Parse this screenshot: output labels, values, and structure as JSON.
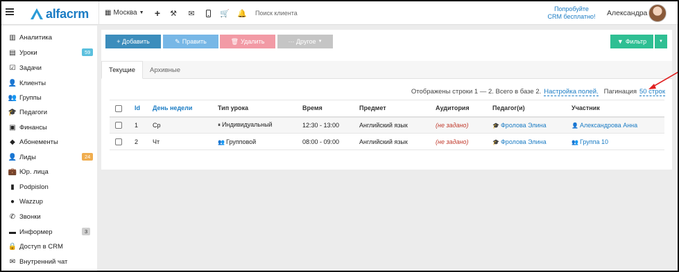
{
  "header": {
    "logo_text": "alfacrm",
    "city": "Москва",
    "search_placeholder": "Поиск клиента",
    "promo_line1": "Попробуйте",
    "promo_line2": "CRM бесплатно!",
    "user_name": "Александра"
  },
  "sidebar": {
    "items": [
      {
        "label": "Аналитика",
        "icon": "analytics-icon"
      },
      {
        "label": "Уроки",
        "icon": "calendar-icon",
        "badge": "59"
      },
      {
        "label": "Задачи",
        "icon": "tasks-icon"
      },
      {
        "label": "Клиенты",
        "icon": "user-icon"
      },
      {
        "label": "Группы",
        "icon": "users-icon"
      },
      {
        "label": "Педагоги",
        "icon": "graduation-cap-icon"
      },
      {
        "label": "Финансы",
        "icon": "money-icon"
      },
      {
        "label": "Абонементы",
        "icon": "tag-icon"
      },
      {
        "label": "Лиды",
        "icon": "user-plus-icon",
        "badge": "24"
      },
      {
        "label": "Юр. лица",
        "icon": "briefcase-icon"
      },
      {
        "label": "Podpislon",
        "icon": "document-icon"
      },
      {
        "label": "Wazzup",
        "icon": "whatsapp-icon"
      },
      {
        "label": "Звонки",
        "icon": "phone-icon"
      },
      {
        "label": "Информер",
        "icon": "book-icon",
        "badge": "3"
      },
      {
        "label": "Доступ в CRM",
        "icon": "lock-icon"
      },
      {
        "label": "Внутренний чат",
        "icon": "chat-icon"
      }
    ],
    "badge_colors": {
      "59": "#5bc0de",
      "24": "#f0ad4e",
      "3": "#cfcfcf"
    }
  },
  "toolbar": {
    "add": "+ Добавить",
    "edit": "Править",
    "delete": "Удалить",
    "other": "··· Другое",
    "filter": "Фильтр",
    "colors": {
      "add": "#3c8dbc",
      "edit": "#77b7e6",
      "delete": "#f29aa5",
      "other": "#c5c5c5",
      "filter": "#2fbf93"
    }
  },
  "tabs": {
    "current": "Текущие",
    "archive": "Архивные"
  },
  "pager": {
    "summary": "Отображены строки 1 — 2. Всего в базе 2.",
    "settings_link": "Настройка полей.",
    "pagination_label": "Пагинация",
    "rows_link": "50 строк"
  },
  "table": {
    "columns": [
      "Id",
      "День недели",
      "Тип урока",
      "Время",
      "Предмет",
      "Аудитория",
      "Педагог(и)",
      "Участник"
    ],
    "rows": [
      {
        "id": "1",
        "day": "Ср",
        "type": "Индивидуальный",
        "time": "12:30 - 13:00",
        "subject": "Английский язык",
        "room": "(не задано)",
        "teacher": "Фролова Элина",
        "participant": "Александрова Анна"
      },
      {
        "id": "2",
        "day": "Чт",
        "type": "Групповой",
        "time": "08:00 - 09:00",
        "subject": "Английский язык",
        "room": "(не задано)",
        "teacher": "Фролова Элина",
        "participant": "Группа 10"
      }
    ]
  }
}
